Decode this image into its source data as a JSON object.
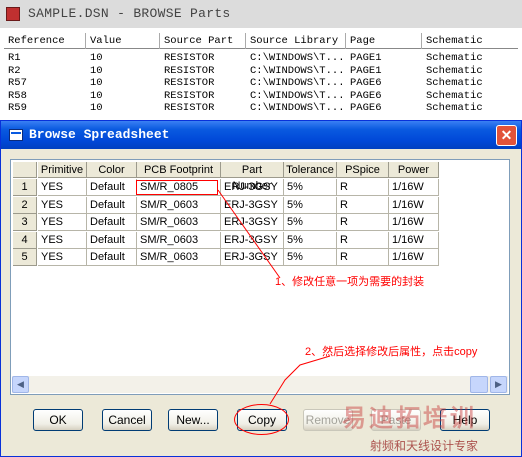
{
  "background_window": {
    "title": "SAMPLE.DSN - BROWSE Parts",
    "columns": [
      "Reference",
      "Value",
      "Source Part",
      "Source Library",
      "Page",
      "Schematic"
    ],
    "rows": [
      [
        "R1",
        "10",
        "RESISTOR",
        "C:\\WINDOWS\\T...",
        "PAGE1",
        "Schematic"
      ],
      [
        "R2",
        "10",
        "RESISTOR",
        "C:\\WINDOWS\\T...",
        "PAGE1",
        "Schematic"
      ],
      [
        "R57",
        "10",
        "RESISTOR",
        "C:\\WINDOWS\\T...",
        "PAGE6",
        "Schematic"
      ],
      [
        "R58",
        "10",
        "RESISTOR",
        "C:\\WINDOWS\\T...",
        "PAGE6",
        "Schematic"
      ],
      [
        "R59",
        "10",
        "RESISTOR",
        "C:\\WINDOWS\\T...",
        "PAGE6",
        "Schematic"
      ]
    ]
  },
  "dialog": {
    "title": "Browse Spreadsheet",
    "close_symbol": "✕",
    "grid": {
      "columns": [
        "Primitive",
        "Color",
        "PCB Footprint",
        "Part Number",
        "Tolerance",
        "PSpice",
        "Power"
      ],
      "row_numbers": [
        "1",
        "2",
        "3",
        "4",
        "5"
      ],
      "rows": [
        [
          "YES",
          "Default",
          "SM/R_0805",
          "ERJ-3GSY",
          "5%",
          "R",
          "1/16W"
        ],
        [
          "YES",
          "Default",
          "SM/R_0603",
          "ERJ-3GSY",
          "5%",
          "R",
          "1/16W"
        ],
        [
          "YES",
          "Default",
          "SM/R_0603",
          "ERJ-3GSY",
          "5%",
          "R",
          "1/16W"
        ],
        [
          "YES",
          "Default",
          "SM/R_0603",
          "ERJ-3GSY",
          "5%",
          "R",
          "1/16W"
        ],
        [
          "YES",
          "Default",
          "SM/R_0603",
          "ERJ-3GSY",
          "5%",
          "R",
          "1/16W"
        ]
      ]
    },
    "buttons": {
      "ok": "OK",
      "cancel": "Cancel",
      "new": "New...",
      "copy": "Copy",
      "remove": "Remove",
      "paste": "Paste",
      "help": "Help"
    }
  },
  "annotations": {
    "step1": "1、修改任意一项为需要的封装",
    "step2": "2、然后选择修改后属性，点击copy",
    "color": "#ff0000"
  },
  "watermark": {
    "main": "易迪拓培训",
    "sub": "射频和天线设计专家"
  },
  "icons": {
    "scroll_left": "◀",
    "scroll_right": "▶"
  }
}
